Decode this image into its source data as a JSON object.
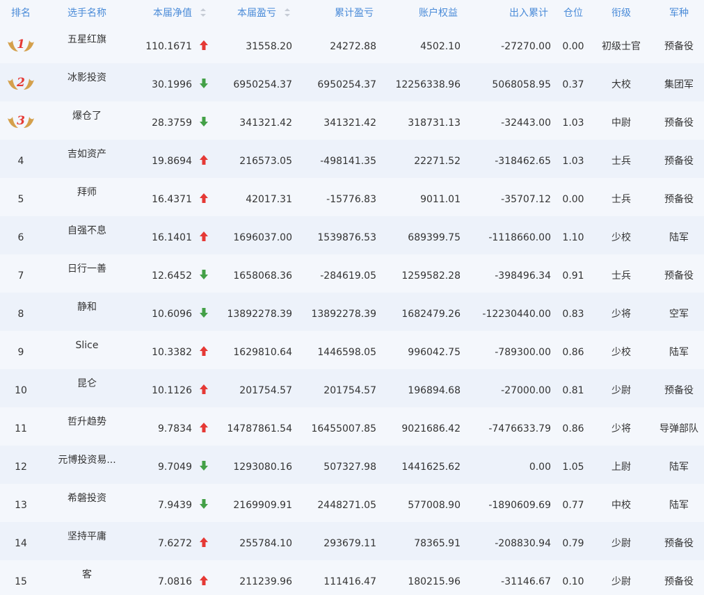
{
  "columns": {
    "rank": "排名",
    "player": "选手名称",
    "net_value": "本届净值",
    "profit": "本届盈亏",
    "cumulative": "累计盈亏",
    "equity": "账户权益",
    "flow": "出入累计",
    "position": "仓位",
    "title": "衔级",
    "branch": "军种"
  },
  "colors": {
    "up": "#e53935",
    "down": "#43a047",
    "header": "#4a8bd8",
    "medal": "#d4a04c"
  },
  "rows": [
    {
      "rank": "1",
      "player": "五星红旗",
      "net": "110.1671",
      "trend": "up",
      "profit": "31558.20",
      "cumulative": "24272.88",
      "equity": "4502.10",
      "flow": "-27270.00",
      "position": "0.00",
      "title": "初级士官",
      "branch": "预备役",
      "medal": true
    },
    {
      "rank": "2",
      "player": "冰影投资",
      "net": "30.1996",
      "trend": "down",
      "profit": "6950254.37",
      "cumulative": "6950254.37",
      "equity": "12256338.96",
      "flow": "5068058.95",
      "position": "0.37",
      "title": "大校",
      "branch": "集团军",
      "medal": true
    },
    {
      "rank": "3",
      "player": "爆仓了",
      "net": "28.3759",
      "trend": "down",
      "profit": "341321.42",
      "cumulative": "341321.42",
      "equity": "318731.13",
      "flow": "-32443.00",
      "position": "1.03",
      "title": "中尉",
      "branch": "预备役",
      "medal": true
    },
    {
      "rank": "4",
      "player": "吉如资产",
      "net": "19.8694",
      "trend": "up",
      "profit": "216573.05",
      "cumulative": "-498141.35",
      "equity": "22271.52",
      "flow": "-318462.65",
      "position": "1.03",
      "title": "士兵",
      "branch": "预备役"
    },
    {
      "rank": "5",
      "player": "拜师",
      "net": "16.4371",
      "trend": "up",
      "profit": "42017.31",
      "cumulative": "-15776.83",
      "equity": "9011.01",
      "flow": "-35707.12",
      "position": "0.00",
      "title": "士兵",
      "branch": "预备役"
    },
    {
      "rank": "6",
      "player": "自强不息",
      "net": "16.1401",
      "trend": "up",
      "profit": "1696037.00",
      "cumulative": "1539876.53",
      "equity": "689399.75",
      "flow": "-1118660.00",
      "position": "1.10",
      "title": "少校",
      "branch": "陆军"
    },
    {
      "rank": "7",
      "player": "日行一善",
      "net": "12.6452",
      "trend": "down",
      "profit": "1658068.36",
      "cumulative": "-284619.05",
      "equity": "1259582.28",
      "flow": "-398496.34",
      "position": "0.91",
      "title": "士兵",
      "branch": "预备役"
    },
    {
      "rank": "8",
      "player": "静和",
      "net": "10.6096",
      "trend": "down",
      "profit": "13892278.39",
      "cumulative": "13892278.39",
      "equity": "1682479.26",
      "flow": "-12230440.00",
      "position": "0.83",
      "title": "少将",
      "branch": "空军"
    },
    {
      "rank": "9",
      "player": "Slice",
      "net": "10.3382",
      "trend": "up",
      "profit": "1629810.64",
      "cumulative": "1446598.05",
      "equity": "996042.75",
      "flow": "-789300.00",
      "position": "0.86",
      "title": "少校",
      "branch": "陆军"
    },
    {
      "rank": "10",
      "player": "昆仑",
      "net": "10.1126",
      "trend": "up",
      "profit": "201754.57",
      "cumulative": "201754.57",
      "equity": "196894.68",
      "flow": "-27000.00",
      "position": "0.81",
      "title": "少尉",
      "branch": "预备役"
    },
    {
      "rank": "11",
      "player": "哲升趋势",
      "net": "9.7834",
      "trend": "up",
      "profit": "14787861.54",
      "cumulative": "16455007.85",
      "equity": "9021686.42",
      "flow": "-7476633.79",
      "position": "0.86",
      "title": "少将",
      "branch": "导弹部队"
    },
    {
      "rank": "12",
      "player": "元博投资易...",
      "net": "9.7049",
      "trend": "down",
      "profit": "1293080.16",
      "cumulative": "507327.98",
      "equity": "1441625.62",
      "flow": "0.00",
      "position": "1.05",
      "title": "上尉",
      "branch": "陆军"
    },
    {
      "rank": "13",
      "player": "希磐投资",
      "net": "7.9439",
      "trend": "down",
      "profit": "2169909.91",
      "cumulative": "2448271.05",
      "equity": "577008.90",
      "flow": "-1890609.69",
      "position": "0.77",
      "title": "中校",
      "branch": "陆军"
    },
    {
      "rank": "14",
      "player": "坚持平庸",
      "net": "7.6272",
      "trend": "up",
      "profit": "255784.10",
      "cumulative": "293679.11",
      "equity": "78365.91",
      "flow": "-208830.94",
      "position": "0.79",
      "title": "少尉",
      "branch": "预备役"
    },
    {
      "rank": "15",
      "player": "客",
      "net": "7.0816",
      "trend": "up",
      "profit": "211239.96",
      "cumulative": "111416.47",
      "equity": "180215.96",
      "flow": "-31146.67",
      "position": "0.10",
      "title": "少尉",
      "branch": "预备役"
    }
  ]
}
